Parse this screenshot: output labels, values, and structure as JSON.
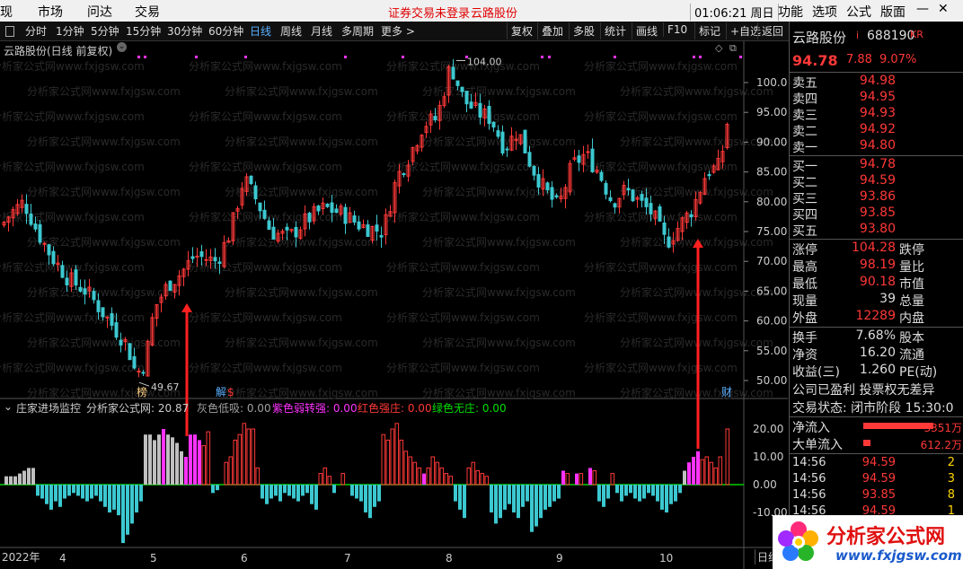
{
  "menubar": {
    "items": [
      "现",
      "市场",
      "问达",
      "交易"
    ],
    "notice": "证券交易未登录",
    "stock_link": "云路股份",
    "clock": "01:06:21 周日",
    "right_items": [
      "功能",
      "选项",
      "公式",
      "版面"
    ]
  },
  "toolbar": {
    "periods": [
      "分时",
      "1分钟",
      "5分钟",
      "15分钟",
      "30分钟",
      "60分钟",
      "日线",
      "周线",
      "月线",
      "多周期",
      "更多 >"
    ],
    "active_period": "日线",
    "right_buttons": [
      "复权",
      "叠加",
      "多股",
      "统计",
      "画线",
      "F10",
      "标记",
      "+自选",
      "返回"
    ]
  },
  "chart": {
    "title": "云路股份(日线 前复权)",
    "price_ticks": [
      "100.0",
      "95.00",
      "90.00",
      "85.00",
      "80.00",
      "75.00",
      "70.00",
      "65.00",
      "60.00",
      "55.00",
      "50.00"
    ],
    "high_marker": "104.00",
    "low_marker": "49.67",
    "markers": [
      "榜",
      "解",
      "$",
      "财"
    ],
    "indicator_title": "庄家进场监控",
    "indicator_source": "分析家公式网: 20.87",
    "legend": [
      {
        "text": "灰色低吸: 0.00",
        "color": "#a0a0a0"
      },
      {
        "text": "紫色弱转强: 0.00",
        "color": "#ff33ff"
      },
      {
        "text": "红色强庄: 0.00",
        "color": "#ff3838"
      },
      {
        "text": "绿色无庄: 0.00",
        "color": "#00e000"
      }
    ],
    "ind_ticks": [
      "20.00",
      "10.00",
      "0.00",
      "-10.00"
    ],
    "x_labels": [
      "2022年",
      "4",
      "5",
      "6",
      "7",
      "8",
      "9",
      "10"
    ],
    "bottom_tab": "日线",
    "watermark": "分析家公式网www.fxjgsw.com",
    "colors": {
      "up": "#ff3838",
      "down": "#3cc8d0",
      "gray": "#c0c0c0",
      "purple": "#ff33ff"
    }
  },
  "panel": {
    "name": "云路股份",
    "code": "688190",
    "tag": "KR",
    "price": "94.78",
    "change": "7.88",
    "pct": "9.07%",
    "asks": [
      {
        "label": "卖五",
        "price": "94.98"
      },
      {
        "label": "卖四",
        "price": "94.95"
      },
      {
        "label": "卖三",
        "price": "94.93"
      },
      {
        "label": "卖二",
        "price": "94.92"
      },
      {
        "label": "卖一",
        "price": "94.80"
      }
    ],
    "bids": [
      {
        "label": "买一",
        "price": "94.78"
      },
      {
        "label": "买二",
        "price": "94.59"
      },
      {
        "label": "买三",
        "price": "93.86"
      },
      {
        "label": "买四",
        "price": "93.85"
      },
      {
        "label": "买五",
        "price": "93.80"
      }
    ],
    "stats": [
      {
        "l1": "涨停",
        "v1": "104.28",
        "c1": "red",
        "l2": "跌停"
      },
      {
        "l1": "最高",
        "v1": "98.19",
        "c1": "red",
        "l2": "量比"
      },
      {
        "l1": "最低",
        "v1": "90.18",
        "c1": "red",
        "l2": "市值"
      },
      {
        "l1": "现量",
        "v1": "39",
        "c1": "white",
        "l2": "总量"
      },
      {
        "l1": "外盘",
        "v1": "12289",
        "c1": "red",
        "l2": "内盘"
      }
    ],
    "stats2": [
      {
        "l1": "换手",
        "v1": "7.68%",
        "l2": "股本"
      },
      {
        "l1": "净资",
        "v1": "16.20",
        "l2": "流通"
      },
      {
        "l1": "收益(三)",
        "v1": "1.260",
        "l2": "PE(动)"
      }
    ],
    "info1": "公司已盈利 投票权无差异",
    "info2": "交易状态: 闭市阶段 15:30:0",
    "flow": [
      {
        "label": "净流入",
        "value": "3351万"
      },
      {
        "label": "大单流入",
        "value": "612.2万"
      }
    ],
    "ticks": [
      {
        "time": "14:56",
        "price": "94.59",
        "vol": "2"
      },
      {
        "time": "14:56",
        "price": "94.59",
        "vol": "3"
      },
      {
        "time": "14:56",
        "price": "93.85",
        "vol": "8"
      },
      {
        "time": "14:56",
        "price": "94.59",
        "vol": "1"
      }
    ]
  },
  "brand": {
    "name": "分析家公式网",
    "url": "www.fxjgsw.com"
  }
}
